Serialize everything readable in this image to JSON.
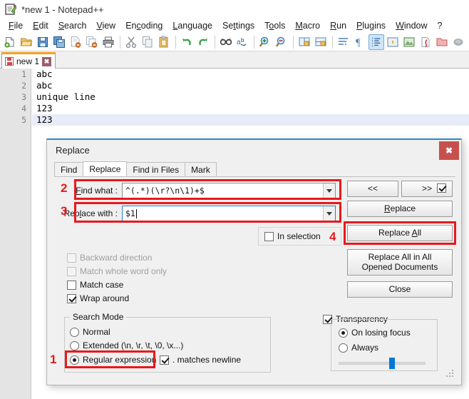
{
  "window": {
    "title": "*new 1 - Notepad++",
    "icon": "notepad-plus-plus-icon"
  },
  "menubar": {
    "items": [
      {
        "label": "File",
        "mnemonic": "F"
      },
      {
        "label": "Edit",
        "mnemonic": "E"
      },
      {
        "label": "Search",
        "mnemonic": "S"
      },
      {
        "label": "View",
        "mnemonic": "V"
      },
      {
        "label": "Encoding",
        "mnemonic": "c"
      },
      {
        "label": "Language",
        "mnemonic": "L"
      },
      {
        "label": "Settings",
        "mnemonic": "t"
      },
      {
        "label": "Tools",
        "mnemonic": "o"
      },
      {
        "label": "Macro",
        "mnemonic": "M"
      },
      {
        "label": "Run",
        "mnemonic": "R"
      },
      {
        "label": "Plugins",
        "mnemonic": "P"
      },
      {
        "label": "Window",
        "mnemonic": "W"
      },
      {
        "label": "?",
        "mnemonic": "?"
      }
    ]
  },
  "toolbar": {
    "items": [
      {
        "name": "new-file-icon"
      },
      {
        "name": "open-file-icon"
      },
      {
        "name": "save-icon"
      },
      {
        "name": "save-all-icon"
      },
      {
        "name": "close-file-icon"
      },
      {
        "name": "close-all-files-icon"
      },
      {
        "name": "print-icon"
      },
      {
        "name": "separator"
      },
      {
        "name": "cut-icon"
      },
      {
        "name": "copy-icon"
      },
      {
        "name": "paste-icon"
      },
      {
        "name": "separator"
      },
      {
        "name": "undo-icon"
      },
      {
        "name": "redo-icon"
      },
      {
        "name": "separator"
      },
      {
        "name": "find-icon"
      },
      {
        "name": "replace-icon"
      },
      {
        "name": "separator"
      },
      {
        "name": "zoom-in-icon"
      },
      {
        "name": "zoom-out-icon"
      },
      {
        "name": "separator"
      },
      {
        "name": "sync-vertical-scroll-icon"
      },
      {
        "name": "sync-horizontal-scroll-icon"
      },
      {
        "name": "separator"
      },
      {
        "name": "word-wrap-icon"
      },
      {
        "name": "show-all-characters-icon"
      },
      {
        "name": "indent-guide-icon"
      },
      {
        "name": "user-defined-language-icon"
      },
      {
        "name": "document-map-icon"
      },
      {
        "name": "function-list-icon"
      },
      {
        "name": "folder-as-workspace-icon"
      },
      {
        "name": "monitoring-icon"
      }
    ]
  },
  "doc_tabs": [
    {
      "label": "new 1",
      "modified": true,
      "active": true
    }
  ],
  "editor": {
    "lines": [
      {
        "number": "1",
        "text": "abc",
        "current": false
      },
      {
        "number": "2",
        "text": "abc",
        "current": false
      },
      {
        "number": "3",
        "text": "unique line",
        "current": false
      },
      {
        "number": "4",
        "text": "123",
        "current": false
      },
      {
        "number": "5",
        "text": "123",
        "current": true
      }
    ]
  },
  "dialog": {
    "title": "Replace",
    "close_label": "✖",
    "tabs": [
      {
        "label": "Find",
        "active": false
      },
      {
        "label": "Replace",
        "active": true
      },
      {
        "label": "Find in Files",
        "active": false
      },
      {
        "label": "Mark",
        "active": false
      }
    ],
    "fields": {
      "find_label": "Find what :",
      "find_value": "^(.*)(\\r?\\n\\1)+$",
      "replace_label": "Replace with :",
      "replace_value": "$1"
    },
    "buttons": {
      "prev": "<<",
      "next": ">>",
      "replace": "Replace",
      "replace_all": "Replace All",
      "replace_all_opened": "Replace All in All Opened Documents",
      "close": "Close"
    },
    "options": {
      "in_selection": {
        "label": "In selection",
        "checked": false,
        "enabled": true
      },
      "backward_direction": {
        "label": "Backward direction",
        "checked": false,
        "enabled": false
      },
      "match_whole_word": {
        "label": "Match whole word only",
        "checked": false,
        "enabled": false
      },
      "match_case": {
        "label": "Match case",
        "checked": false,
        "enabled": true
      },
      "wrap_around": {
        "label": "Wrap around",
        "checked": true,
        "enabled": true
      },
      "find_next_after_replace": {
        "label": "",
        "checked": true,
        "enabled": true
      }
    },
    "search_mode": {
      "title": "Search Mode",
      "options": [
        {
          "label": "Normal",
          "selected": false
        },
        {
          "label": "Extended (\\n, \\r, \\t, \\0, \\x...)",
          "selected": false
        },
        {
          "label": "Regular expression",
          "selected": true
        }
      ],
      "dot_matches_newline": {
        "label": ". matches newline",
        "checked": true
      }
    },
    "transparency": {
      "label": "Transparency",
      "enabled": true,
      "options": [
        {
          "label": "On losing focus",
          "selected": true
        },
        {
          "label": "Always",
          "selected": false
        }
      ],
      "slider_percent": 62
    }
  },
  "annotations": [
    {
      "number": "1",
      "target": "regular-expression-radio"
    },
    {
      "number": "2",
      "target": "find-what-row"
    },
    {
      "number": "3",
      "target": "replace-with-row"
    },
    {
      "number": "4",
      "target": "replace-all-button"
    }
  ],
  "colors": {
    "annotation_red": "#e8191c",
    "dialog_accent": "#2e8bc7",
    "tab_accent": "#f5a21e",
    "close_button": "#c7504f",
    "slider_thumb": "#0078d7"
  }
}
